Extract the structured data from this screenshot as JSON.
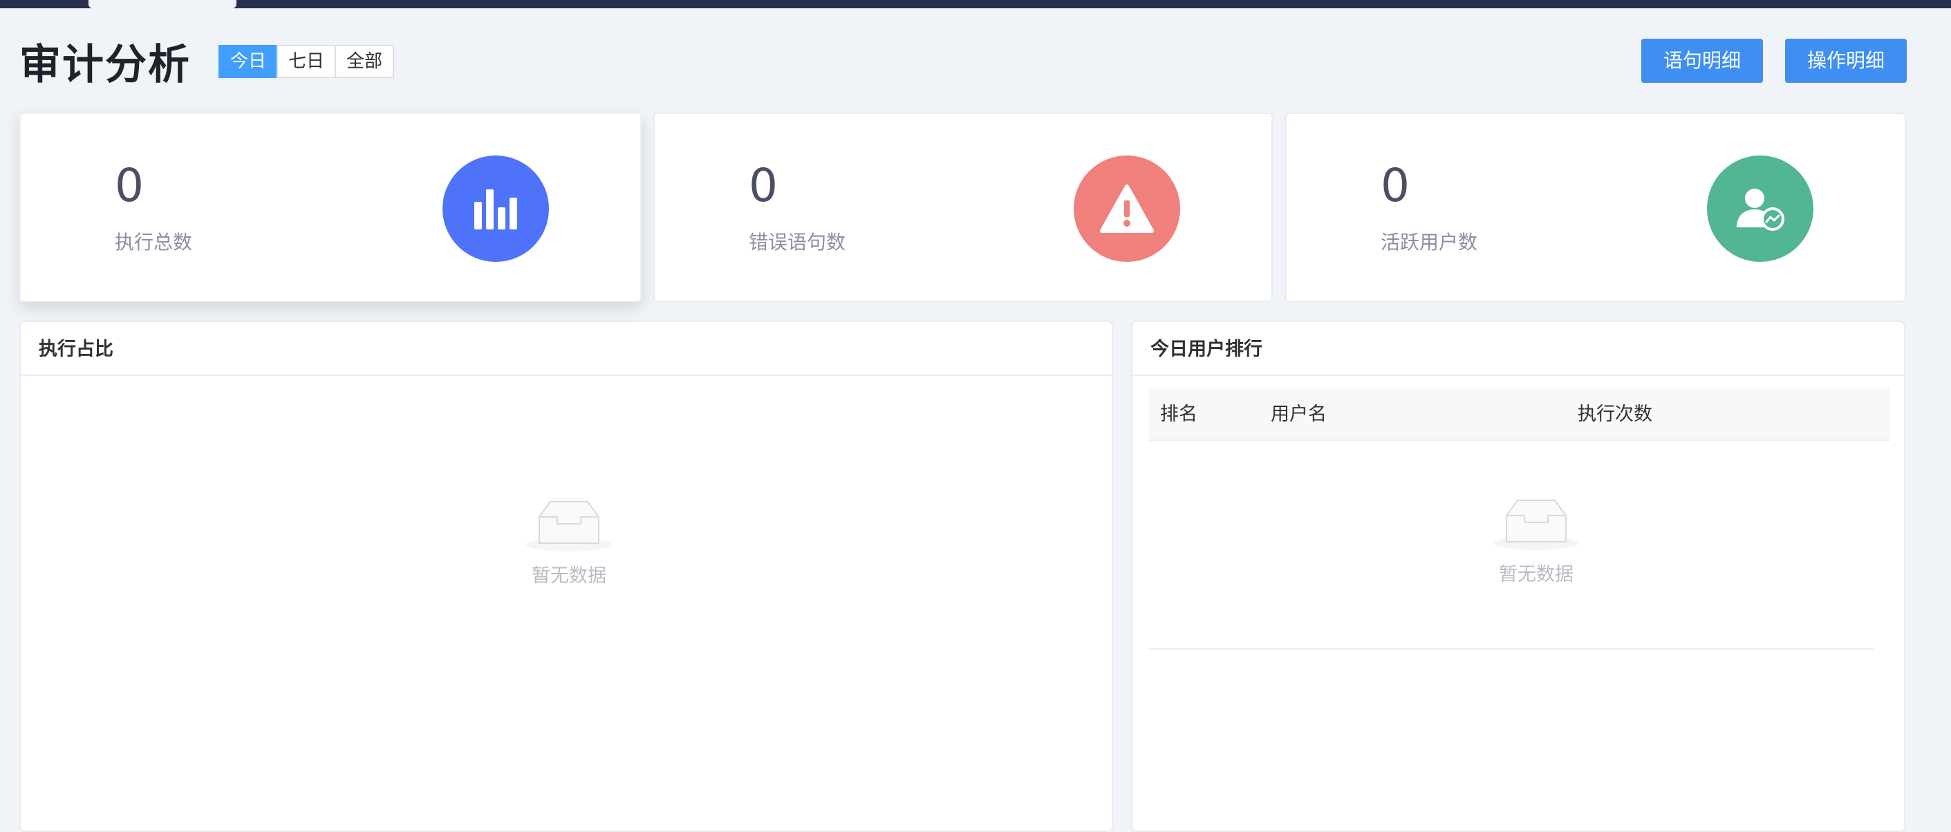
{
  "header": {
    "title": "审计分析",
    "ranges": [
      "今日",
      "七日",
      "全部"
    ],
    "active_range": "今日",
    "statement_detail_label": "语句明细",
    "operation_detail_label": "操作明细"
  },
  "stats": [
    {
      "value": "0",
      "label": "执行总数",
      "icon": "bar-chart-icon",
      "color": "#4e73f8"
    },
    {
      "value": "0",
      "label": "错误语句数",
      "icon": "warning-icon",
      "color": "#f0807b"
    },
    {
      "value": "0",
      "label": "活跃用户数",
      "icon": "user-activity-icon",
      "color": "#52b596"
    }
  ],
  "exec_ratio_panel": {
    "title": "执行占比",
    "empty_text": "暂无数据"
  },
  "user_rank_panel": {
    "title": "今日用户排行",
    "columns": [
      "排名",
      "用户名",
      "执行次数"
    ],
    "empty_text": "暂无数据"
  }
}
